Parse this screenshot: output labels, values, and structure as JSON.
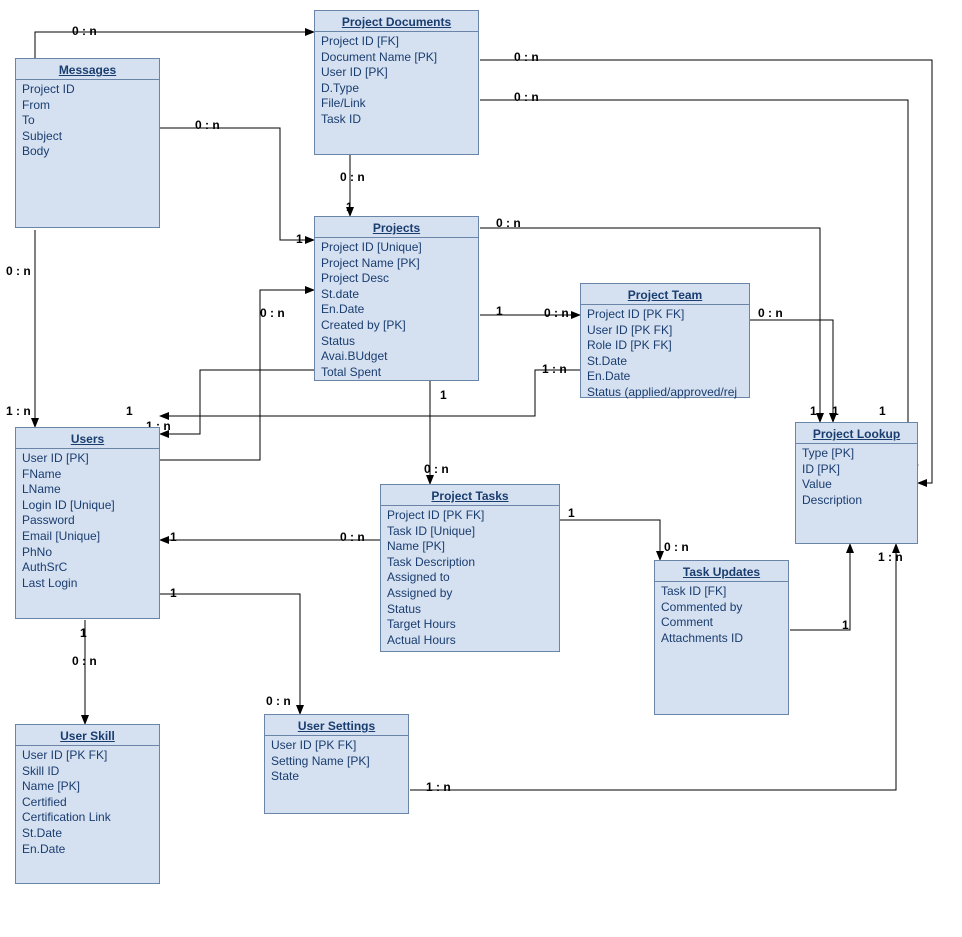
{
  "entities": {
    "messages": {
      "title": "Messages",
      "attrs": [
        "Project ID",
        "From",
        "To",
        "Subject",
        "Body"
      ]
    },
    "project_documents": {
      "title": "Project Documents",
      "attrs": [
        "Project ID [FK]",
        "Document Name [PK]",
        "User ID [PK]",
        "D.Type",
        "File/Link",
        "Task ID"
      ]
    },
    "projects": {
      "title": "Projects",
      "attrs": [
        "Project ID [Unique]",
        "Project Name [PK]",
        "Project Desc",
        "St.date",
        "En.Date",
        "Created by [PK]",
        "Status",
        "Avai.BUdget",
        "Total Spent"
      ]
    },
    "project_team": {
      "title": "Project Team",
      "attrs": [
        "Project ID [PK FK]",
        "User ID [PK FK]",
        "Role ID [PK FK]",
        "St.Date",
        "En.Date",
        "Status (applied/approved/rej"
      ]
    },
    "project_lookup": {
      "title": "Project Lookup",
      "attrs": [
        "Type [PK]",
        "ID [PK]",
        "Value",
        "Description"
      ]
    },
    "users": {
      "title": "Users",
      "attrs": [
        "User ID [PK]",
        "FName",
        "LName",
        "Login ID [Unique]",
        "Password",
        "Email  [Unique]",
        "PhNo",
        "AuthSrC",
        "Last Login"
      ]
    },
    "project_tasks": {
      "title": "Project Tasks",
      "attrs": [
        "Project ID [PK FK]",
        "Task ID [Unique]",
        "Name [PK]",
        "Task Description",
        "Assigned to",
        "Assigned by",
        "Status",
        "Target Hours",
        "Actual Hours"
      ]
    },
    "task_updates": {
      "title": "Task Updates",
      "attrs": [
        "Task ID [FK]",
        "Commented by",
        "Comment",
        "Attachments ID"
      ]
    },
    "user_skill": {
      "title": "User Skill",
      "attrs": [
        "User ID [PK FK]",
        "Skill ID",
        "Name [PK]",
        "Certified",
        "Certification Link",
        "St.Date",
        "En.Date"
      ]
    },
    "user_settings": {
      "title": "User Settings",
      "attrs": [
        "User ID [PK FK]",
        "Setting Name [PK]",
        "State"
      ]
    }
  },
  "labels": {
    "zero_n": "0 : n",
    "one_n": "1 : n",
    "one": "1"
  }
}
